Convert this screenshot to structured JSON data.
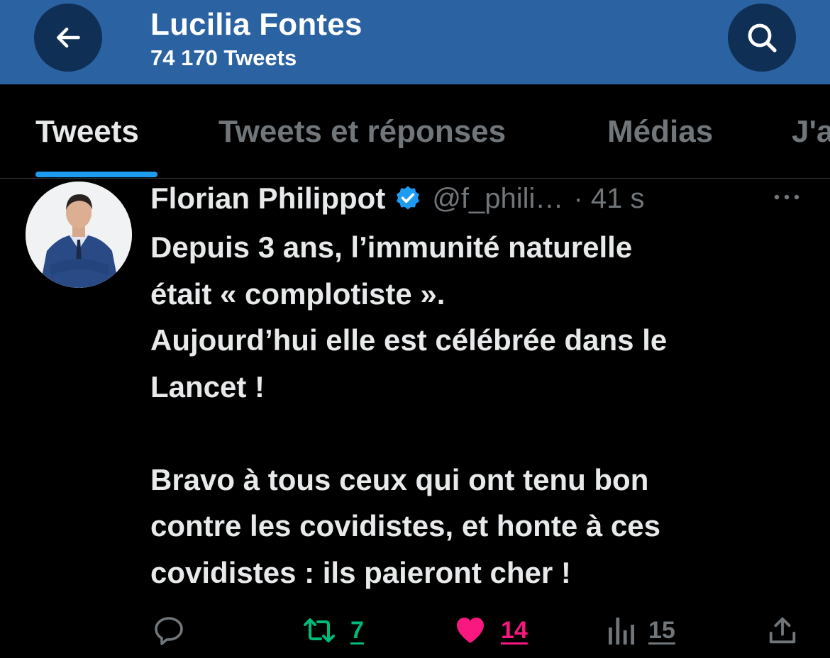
{
  "header": {
    "title": "Lucilia Fontes",
    "subtitle": "74 170 Tweets",
    "back_icon": "arrow-left-icon",
    "search_icon": "search-icon"
  },
  "tabs": [
    {
      "label": "Tweets",
      "active": true
    },
    {
      "label": "Tweets et réponses",
      "active": false
    },
    {
      "label": "Médias",
      "active": false
    },
    {
      "label": "J'a",
      "active": false
    }
  ],
  "tweet": {
    "author": "Florian Philippot",
    "verified": true,
    "handle": "@f_phili…",
    "time": "· 41 s",
    "text_lines": [
      "Depuis 3 ans, l’immunité naturelle",
      "était « complotiste ».",
      "Aujourd’hui elle est célébrée dans le",
      "Lancet !",
      "",
      "Bravo à tous ceux qui ont tenu bon",
      "contre les covidistes, et honte à ces",
      "covidistes : ils paieront cher !"
    ],
    "actions": {
      "reply": {
        "icon": "reply-icon",
        "count": ""
      },
      "retweet": {
        "icon": "retweet-icon",
        "count": "7"
      },
      "like": {
        "icon": "heart-icon",
        "count": "14"
      },
      "views": {
        "icon": "views-icon",
        "count": "15"
      },
      "share": {
        "icon": "share-icon"
      }
    }
  },
  "colors": {
    "header_bg": "#2b62a2",
    "header_button_bg": "#0f2f55",
    "accent_blue": "#1d9bf0",
    "retweet_green": "#00ba7c",
    "like_pink": "#f91880",
    "muted": "#71767b"
  }
}
